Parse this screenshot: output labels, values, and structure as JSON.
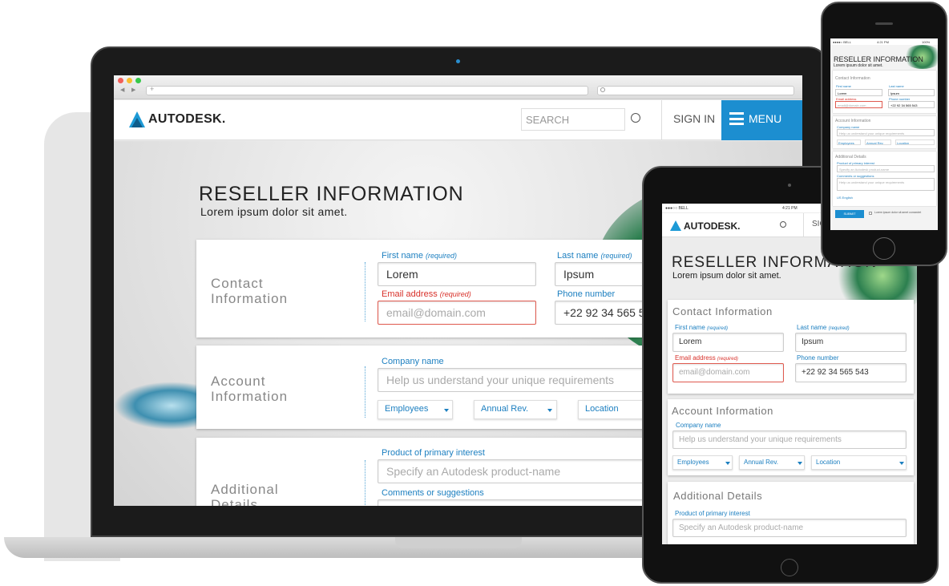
{
  "browser": {
    "back": "◀",
    "forward": "▶",
    "new_tab": "+"
  },
  "site": {
    "brand": "AUTODESK.",
    "search_placeholder": "SEARCH",
    "sign_in": "SIGN IN",
    "menu": "MENU"
  },
  "page": {
    "title": "RESELLER INFORMATION",
    "subtitle": "Lorem ipsum dolor sit amet."
  },
  "contact": {
    "heading_line1": "Contact",
    "heading_line2": "Information",
    "heading": "Contact Information",
    "first_name_label": "First name",
    "last_name_label": "Last name",
    "required": "(required)",
    "first_name_value": "Lorem",
    "last_name_value": "Ipsum",
    "email_label": "Email address",
    "email_placeholder": "email@domain.com",
    "phone_label": "Phone number",
    "phone_value_laptop": "+22 92 34 565 5",
    "phone_value": "+22 92 34 565 543"
  },
  "account": {
    "heading_line1": "Account",
    "heading_line2": "Information",
    "heading": "Account Information",
    "company_label": "Company name",
    "company_placeholder": "Help us understand your unique requirements",
    "selects": [
      "Employees",
      "Annual Rev.",
      "Location"
    ]
  },
  "additional": {
    "heading_line1": "Additional",
    "heading_line2": "Details",
    "heading": "Additional Details",
    "product_label": "Product of primary interest",
    "product_placeholder": "Specify an Autodesk product-name",
    "comments_label": "Comments or suggestions",
    "comments_placeholder": "Help us understand your unique requirements"
  },
  "phone": {
    "carrier": "●●●●○ BELL",
    "time": "4:21 PM",
    "battery": "100%",
    "submit": "SUBMIT",
    "consent": "Lorem ipsum dolor sit amet consectet",
    "language": "US English"
  },
  "tablet": {
    "carrier": "●●●○○ BELL",
    "time": "4:21 PM",
    "sign_in_partial": "SIG"
  },
  "colors": {
    "accent": "#1c8ed0",
    "error": "#d8312a",
    "label": "#1c7fc0"
  }
}
